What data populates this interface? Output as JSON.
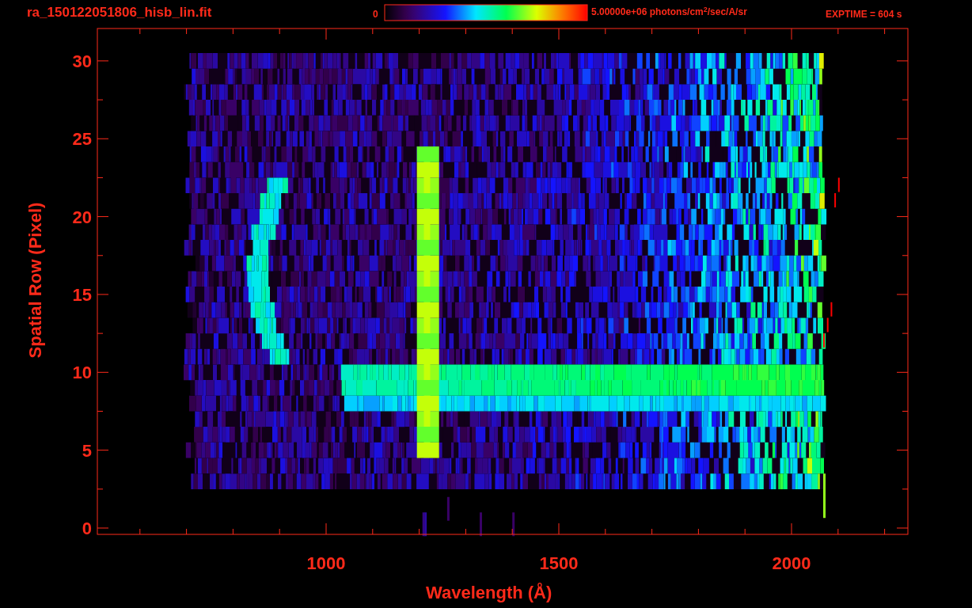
{
  "title": "ra_150122051806_hisb_lin.fit",
  "colorbar": {
    "min_label": "0",
    "max_label": "5.00000e+06 photons/cm$^{2}$/sec/A/sr"
  },
  "exptime": "EXPTIME = 604 s",
  "x_axis": {
    "label": "Wavelength (Å)",
    "ticks": [
      "1000",
      "1500",
      "2000"
    ]
  },
  "y_axis": {
    "label": "Spatial Row (Pixel)",
    "ticks": [
      "30",
      "25",
      "20",
      "15",
      "10",
      "5",
      "0"
    ]
  }
}
